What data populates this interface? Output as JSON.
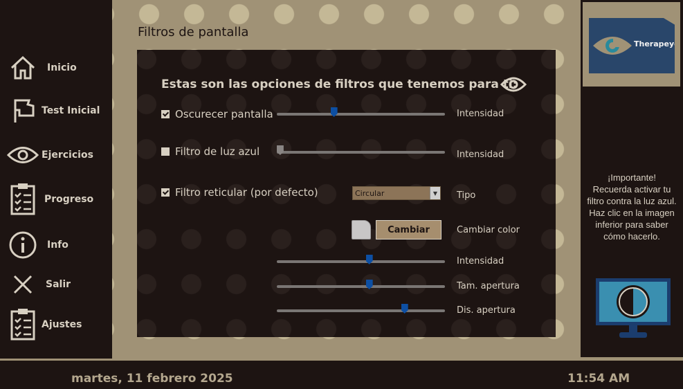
{
  "sidebar": {
    "items": [
      {
        "label": "Inicio",
        "icon": "home-icon"
      },
      {
        "label": "Test Inicial",
        "icon": "flag-icon"
      },
      {
        "label": "Ejercicios",
        "icon": "eye-icon"
      },
      {
        "label": "Progreso",
        "icon": "clipboard-icon"
      },
      {
        "label": "Info",
        "icon": "info-icon"
      },
      {
        "label": "Salir",
        "icon": "close-icon"
      },
      {
        "label": "Ajustes",
        "icon": "clipboard-icon"
      }
    ]
  },
  "page": {
    "title": "Filtros de pantalla"
  },
  "filters": {
    "heading": "Estas son las opciones de filtros que tenemos para ti:",
    "darken": {
      "label": "Oscurecer pantalla",
      "checked": true,
      "slider_label": "Intensidad",
      "value": 0.34
    },
    "blue_light": {
      "label": "Filtro de luz azul",
      "checked": false,
      "slider_label": "Intensidad",
      "value": 0.02
    },
    "grid": {
      "label": "Filtro reticular (por defecto)",
      "checked": true,
      "type_value": "Circular",
      "type_label": "Tipo",
      "change_button": "Cambiar",
      "change_label": "Cambiar color",
      "intensity_label": "Intensidad",
      "intensity_value": 0.55,
      "aperture_size_label": "Tam. apertura",
      "aperture_size_value": 0.55,
      "aperture_dist_label": "Dis. apertura",
      "aperture_dist_value": 0.76
    }
  },
  "logo": {
    "text": "Therapeye"
  },
  "notice": {
    "line1": "¡Importante!",
    "line2": "Recuerda activar tu filtro contra la luz azul. Haz clic en la imagen inferior para saber cómo hacerlo."
  },
  "status": {
    "date": "martes, 11 febrero 2025",
    "time": "11:54 AM"
  },
  "colors": {
    "accent": "#0d4fa3",
    "background": "#a09276",
    "panel": "#1d1412"
  }
}
